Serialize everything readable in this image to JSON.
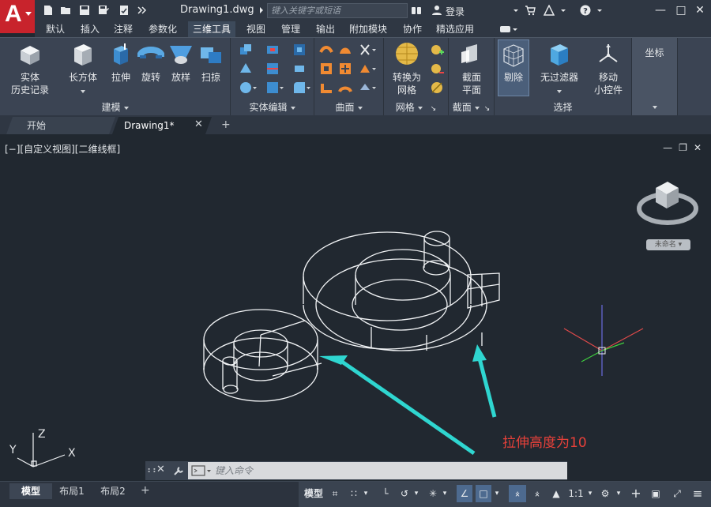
{
  "titlebar": {
    "document_title": "Drawing1.dwg",
    "search_placeholder": "键入关键字或短语",
    "login": "登录"
  },
  "ribbon_tabs": [
    "默认",
    "插入",
    "注释",
    "参数化",
    "三维工具",
    "视图",
    "管理",
    "输出",
    "附加模块",
    "协作",
    "精选应用"
  ],
  "active_tab": "三维工具",
  "panels": {
    "modeling": {
      "title": "建模",
      "history": [
        "实体",
        "历史记录"
      ],
      "box": "长方体",
      "extrude": "拉伸",
      "revolve": "旋转",
      "loft": "放样",
      "sweep": "扫掠"
    },
    "solid_edit": {
      "title": "实体编辑"
    },
    "surface": {
      "title": "曲面"
    },
    "mesh": {
      "title": "网格",
      "convert": [
        "转换为",
        "网格"
      ]
    },
    "section": {
      "title": "截面",
      "plane": [
        "截面",
        "平面"
      ]
    },
    "selection": {
      "title": "选择",
      "cull": "剔除",
      "no_filter": "无过滤器",
      "gizmo": [
        "移动",
        "小控件"
      ]
    },
    "coordinates": {
      "title": "坐标"
    }
  },
  "doc_tabs": {
    "start": "开始",
    "drawing": "Drawing1*"
  },
  "viewport": {
    "view_label": "[−][自定义视图][二维线框]",
    "viewcube_label": "未命名",
    "ucs_x": "X",
    "ucs_y": "Y",
    "ucs_z": "Z",
    "annotation": "拉伸高度为10"
  },
  "command": {
    "placeholder": "键入命令"
  },
  "layouts": {
    "model": "模型",
    "layout1": "布局1",
    "layout2": "布局2"
  },
  "status": {
    "model": "模型",
    "scale": "1:1"
  },
  "colors": {
    "accent_red": "#c8232c",
    "annotation_red": "#e9413a",
    "arrow_cyan": "#2fd6d0",
    "canvas_bg": "#212830"
  }
}
